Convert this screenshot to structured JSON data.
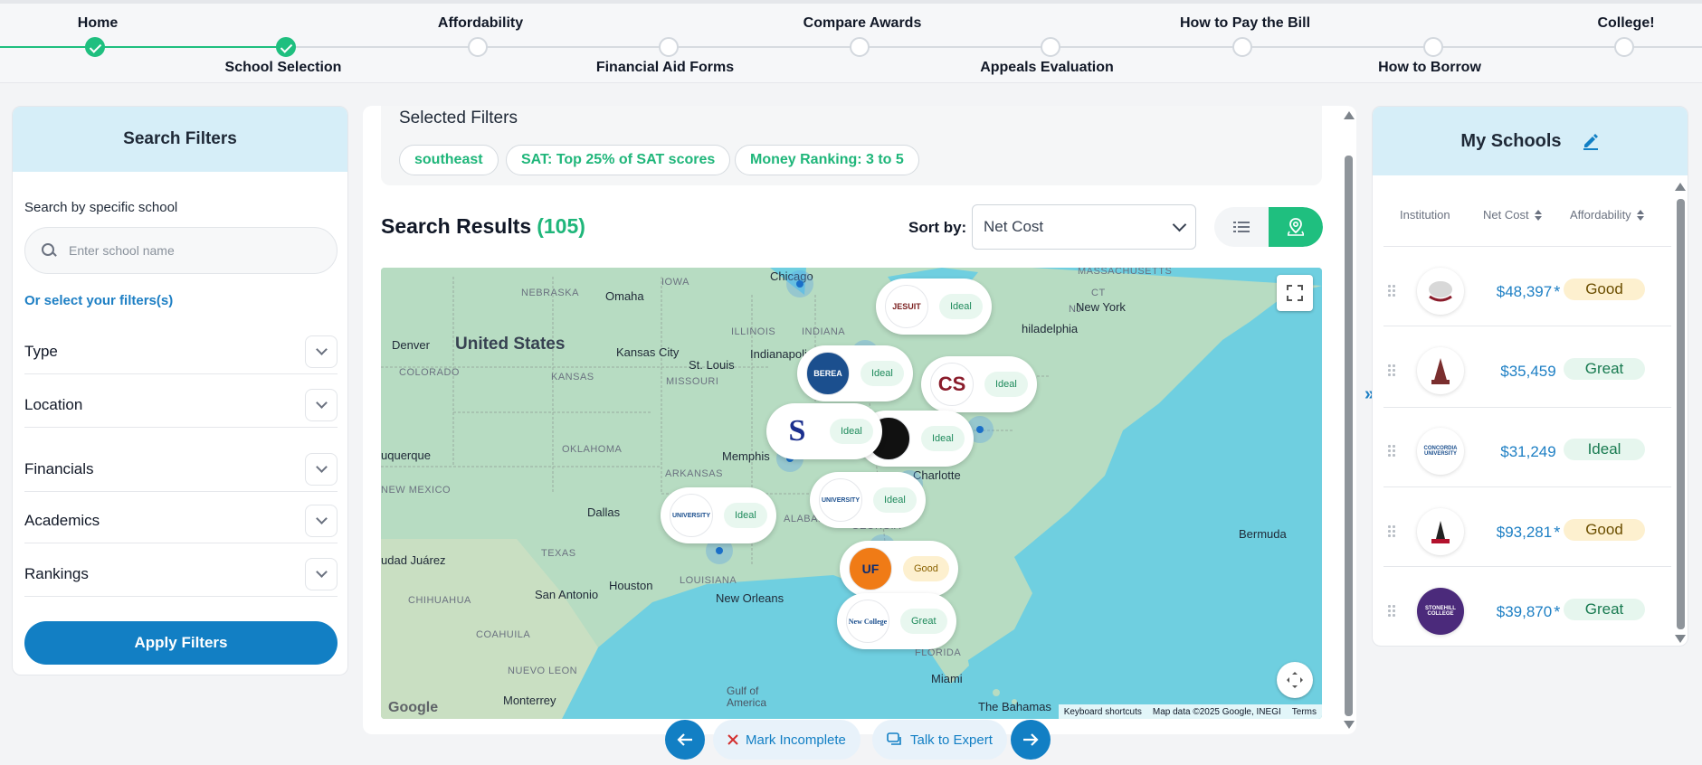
{
  "stepper": {
    "steps": [
      {
        "label": "Home",
        "status": "done"
      },
      {
        "label": "School Selection",
        "status": "done"
      },
      {
        "label": "Affordability",
        "status": "todo"
      },
      {
        "label": "Financial Aid Forms",
        "status": "todo"
      },
      {
        "label": "Compare Awards",
        "status": "todo"
      },
      {
        "label": "Appeals Evaluation",
        "status": "todo"
      },
      {
        "label": "How to Pay the Bill",
        "status": "todo"
      },
      {
        "label": "How to Borrow",
        "status": "todo"
      },
      {
        "label": "College!",
        "status": "todo"
      }
    ]
  },
  "filters": {
    "title": "Search Filters",
    "search_label": "Search by specific school",
    "search_placeholder": "Enter school name",
    "or_select": "Or select your filters(s)",
    "groups": [
      "Type",
      "Location",
      "Financials",
      "Academics",
      "Rankings"
    ],
    "apply_label": "Apply Filters"
  },
  "selected": {
    "title": "Selected Filters",
    "chips": [
      "southeast",
      "SAT: Top 25% of SAT scores",
      "Money Ranking: 3 to 5"
    ]
  },
  "results": {
    "title": "Search Results",
    "count": "(105)",
    "sort_label": "Sort by:",
    "sort_value": "Net Cost"
  },
  "map": {
    "country_label": "United States",
    "labels": {
      "states": [
        "IOWA",
        "NEBRASKA",
        "KANSAS",
        "MISSOURI",
        "ILLINOIS",
        "INDIANA",
        "COLORADO",
        "OKLAHOMA",
        "ARKANSAS",
        "NEW MEXICO",
        "TEXAS",
        "LOUISIANA",
        "ALABAMA",
        "GEORGIA",
        "MASSACHUSETTS",
        "CT",
        "NJ",
        "CHIHUAHUA",
        "COAHUILA",
        "NUEVO LEON",
        "FLORIDA"
      ],
      "cities": [
        "Chicago",
        "Omaha",
        "Denver",
        "Kansas City",
        "St. Louis",
        "Indianapolis",
        "uquerque",
        "Memphis",
        "Dallas",
        "Houston",
        "San Antonio",
        "New Orleans",
        "udad Juárez",
        "Monterrey",
        "Miami",
        "New York",
        "hiladelphia",
        "Charlotte",
        "Bermuda",
        "Gulf of America",
        "The Bahamas"
      ]
    },
    "markers": [
      {
        "logo": "JESUIT",
        "rating": "Ideal"
      },
      {
        "logo": "BEREA",
        "rating": "Ideal"
      },
      {
        "logo": "CS",
        "rating": "Ideal"
      },
      {
        "logo": "S",
        "rating": "Ideal"
      },
      {
        "logo": "",
        "rating": "Ideal"
      },
      {
        "logo": "UNIVERSITY",
        "rating": "Ideal"
      },
      {
        "logo": "UNIVERSITY",
        "rating": "Ideal"
      },
      {
        "logo": "UF",
        "rating": "Good"
      },
      {
        "logo": "New College",
        "rating": "Great"
      }
    ],
    "footer": [
      "Keyboard shortcuts",
      "Map data ©2025 Google, INEGI",
      "Terms"
    ],
    "google": "Google"
  },
  "myschools": {
    "title": "My Schools",
    "columns": [
      "Institution",
      "Net Cost",
      "Affordability"
    ],
    "rows": [
      {
        "logo": "",
        "cost": "$48,397",
        "starred": true,
        "rating": "Good"
      },
      {
        "logo": "",
        "cost": "$35,459",
        "starred": false,
        "rating": "Great"
      },
      {
        "logo": "CONCORDIA UNIVERSITY",
        "cost": "$31,249",
        "starred": false,
        "rating": "Ideal"
      },
      {
        "logo": "",
        "cost": "$93,281",
        "starred": true,
        "rating": "Good"
      },
      {
        "logo": "STONEHILL COLLEGE",
        "cost": "$39,870",
        "starred": true,
        "rating": "Great"
      }
    ]
  },
  "bottom": {
    "mark_incomplete": "Mark Incomplete",
    "talk_to_expert": "Talk to Expert"
  },
  "colors": {
    "accent_green": "#1fbf7f",
    "accent_blue": "#127fc4",
    "panel_header": "#d6eef8"
  }
}
